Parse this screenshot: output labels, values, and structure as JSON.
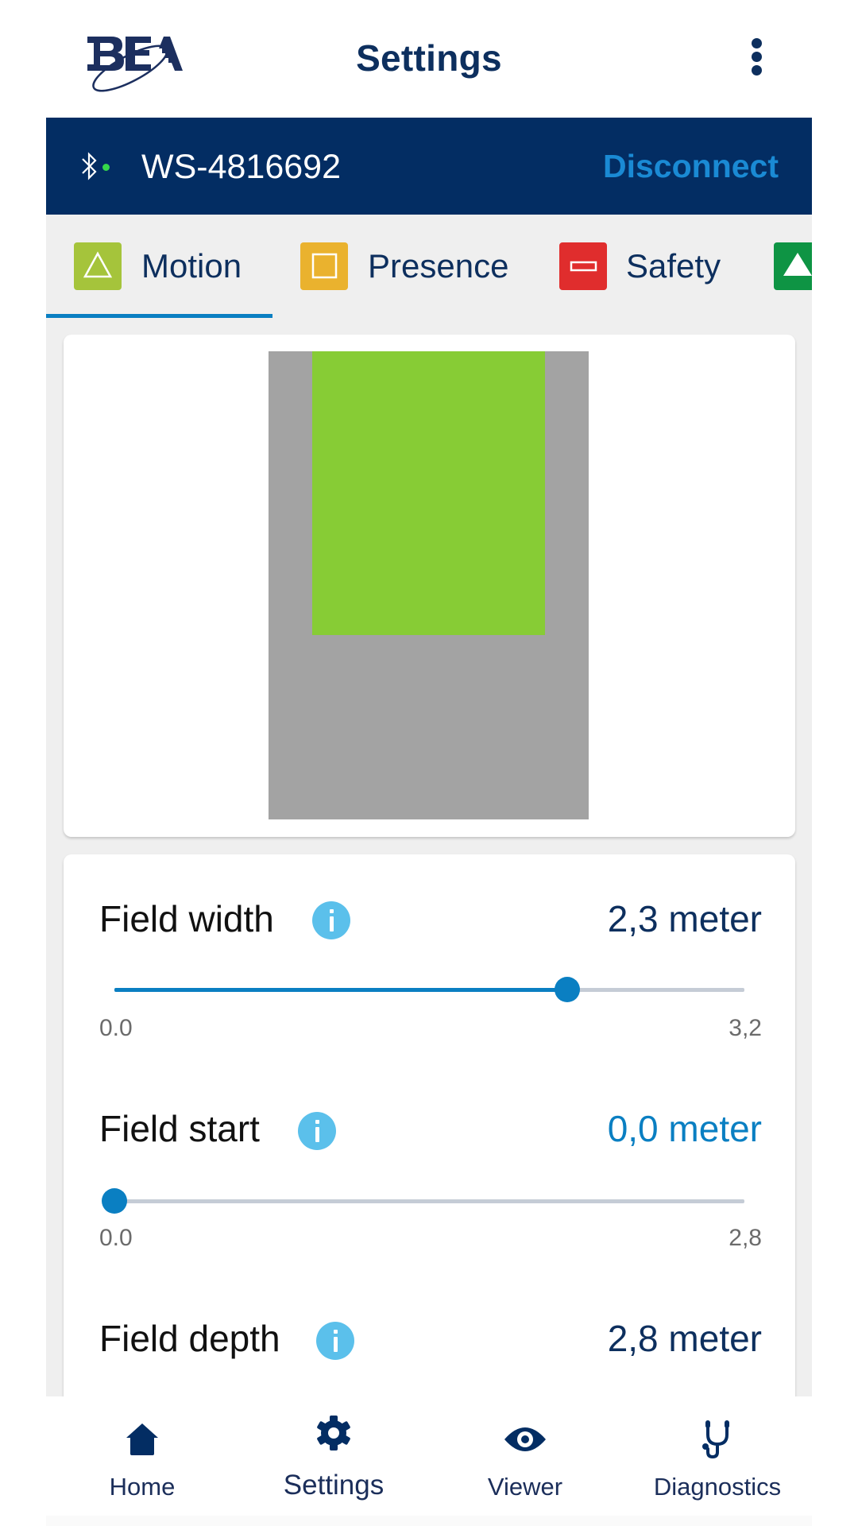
{
  "header": {
    "logo_text": "BEA",
    "title": "Settings",
    "more_icon": "more-vert-icon"
  },
  "device": {
    "bluetooth_icon": "bluetooth-icon",
    "connection_status": "connected",
    "status_color": "#35d84a",
    "name": "WS-4816692",
    "disconnect_label": "Disconnect"
  },
  "tabs": [
    {
      "label": "Motion",
      "icon": "triangle-outline-icon",
      "color": "#a5c43b",
      "active": true
    },
    {
      "label": "Presence",
      "icon": "square-outline-icon",
      "color": "#eab22e",
      "active": false
    },
    {
      "label": "Safety",
      "icon": "rectangle-outline-icon",
      "color": "#e02d2d",
      "active": false
    },
    {
      "label": "",
      "icon": "triangle-filled-icon",
      "color": "#0e9444",
      "active": false
    }
  ],
  "preview": {
    "field_color": "#a3a3a3",
    "zone_color": "#87cc35"
  },
  "settings": [
    {
      "label": "Field width",
      "value": "2,3 meter",
      "numeric_value": 2.3,
      "min_label": "0.0",
      "max_label": "3,2",
      "min": 0,
      "max": 3.2,
      "value_accent": false
    },
    {
      "label": "Field start",
      "value": "0,0 meter",
      "numeric_value": 0.0,
      "min_label": "0.0",
      "max_label": "2,8",
      "min": 0,
      "max": 2.8,
      "value_accent": true
    },
    {
      "label": "Field depth",
      "value": "2,8 meter",
      "value_accent": false
    }
  ],
  "nav": [
    {
      "label": "Home",
      "icon": "home-icon",
      "active": false
    },
    {
      "label": "Settings",
      "icon": "gear-icon",
      "active": true
    },
    {
      "label": "Viewer",
      "icon": "eye-icon",
      "active": false
    },
    {
      "label": "Diagnostics",
      "icon": "stethoscope-icon",
      "active": false
    }
  ],
  "colors": {
    "primary_navy": "#032d63",
    "accent_blue": "#0a7fc2",
    "link_blue": "#1a8ad4",
    "info_blue": "#5bc0eb"
  }
}
